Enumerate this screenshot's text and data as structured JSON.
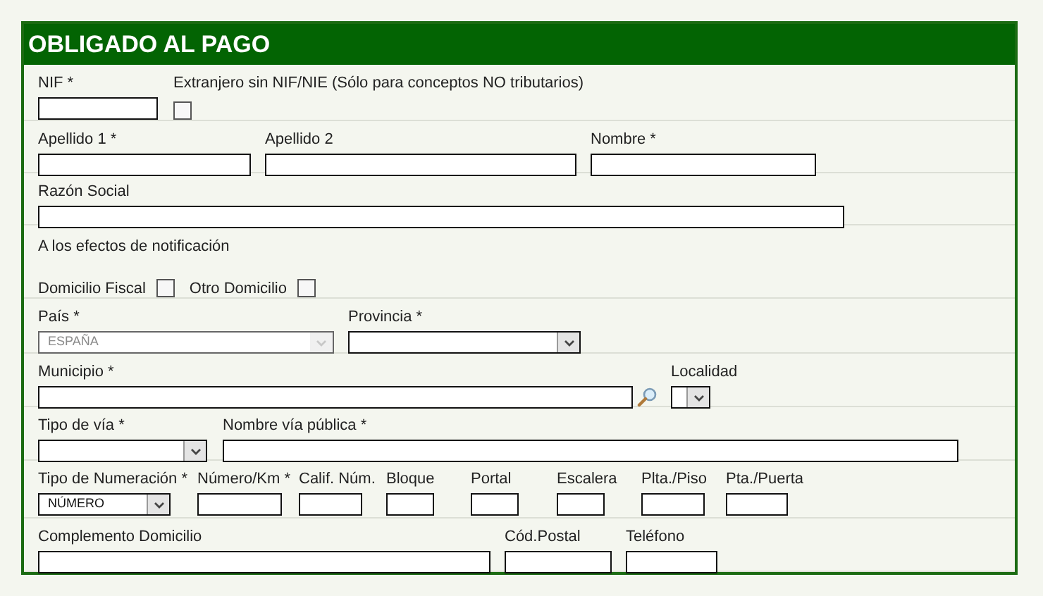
{
  "panel": {
    "title": "OBLIGADO AL PAGO"
  },
  "rows": [
    {
      "fields": [
        {
          "kind": "text",
          "label": "NIF *"
        },
        {
          "kind": "checkbox",
          "label": "Extranjero sin NIF/NIE (Sólo para conceptos NO tributarios)",
          "checked": false
        }
      ]
    },
    {
      "fields": [
        {
          "kind": "text",
          "label": "Apellido 1 *"
        },
        {
          "kind": "text",
          "label": "Apellido 2"
        },
        {
          "kind": "text",
          "label": "Nombre *"
        }
      ]
    },
    {
      "fields": [
        {
          "kind": "text",
          "label": "Razón Social"
        }
      ]
    },
    {
      "note": "A los efectos de notificación",
      "options": [
        {
          "label": "Domicilio Fiscal",
          "checked": false
        },
        {
          "label": "Otro Domicilio",
          "checked": false
        }
      ]
    },
    {
      "fields": [
        {
          "kind": "select",
          "label": "País *",
          "value": "ESPAÑA",
          "disabled": true
        },
        {
          "kind": "select",
          "label": "Provincia *",
          "disabled": false
        }
      ]
    },
    {
      "fields": [
        {
          "kind": "search",
          "label": "Municipio *"
        },
        {
          "kind": "select",
          "label": "Localidad",
          "disabled": false
        }
      ]
    },
    {
      "fields": [
        {
          "kind": "select",
          "label": "Tipo de vía *",
          "disabled": false
        },
        {
          "kind": "text",
          "label": "Nombre vía pública *"
        }
      ]
    },
    {
      "fields": [
        {
          "kind": "select",
          "label": "Tipo de Numeración *",
          "value": "NÚMERO",
          "disabled": false
        },
        {
          "kind": "text",
          "label": "Número/Km *"
        },
        {
          "kind": "text",
          "label": "Calif. Núm."
        },
        {
          "kind": "text",
          "label": "Bloque"
        },
        {
          "kind": "text",
          "label": "Portal"
        },
        {
          "kind": "text",
          "label": "Escalera"
        },
        {
          "kind": "text",
          "label": "Plta./Piso"
        },
        {
          "kind": "text",
          "label": "Pta./Puerta"
        }
      ]
    },
    {
      "fields": [
        {
          "kind": "text",
          "label": "Complemento Domicilio"
        },
        {
          "kind": "text",
          "label": "Cód.Postal"
        },
        {
          "kind": "text",
          "label": "Teléfono"
        }
      ]
    }
  ]
}
